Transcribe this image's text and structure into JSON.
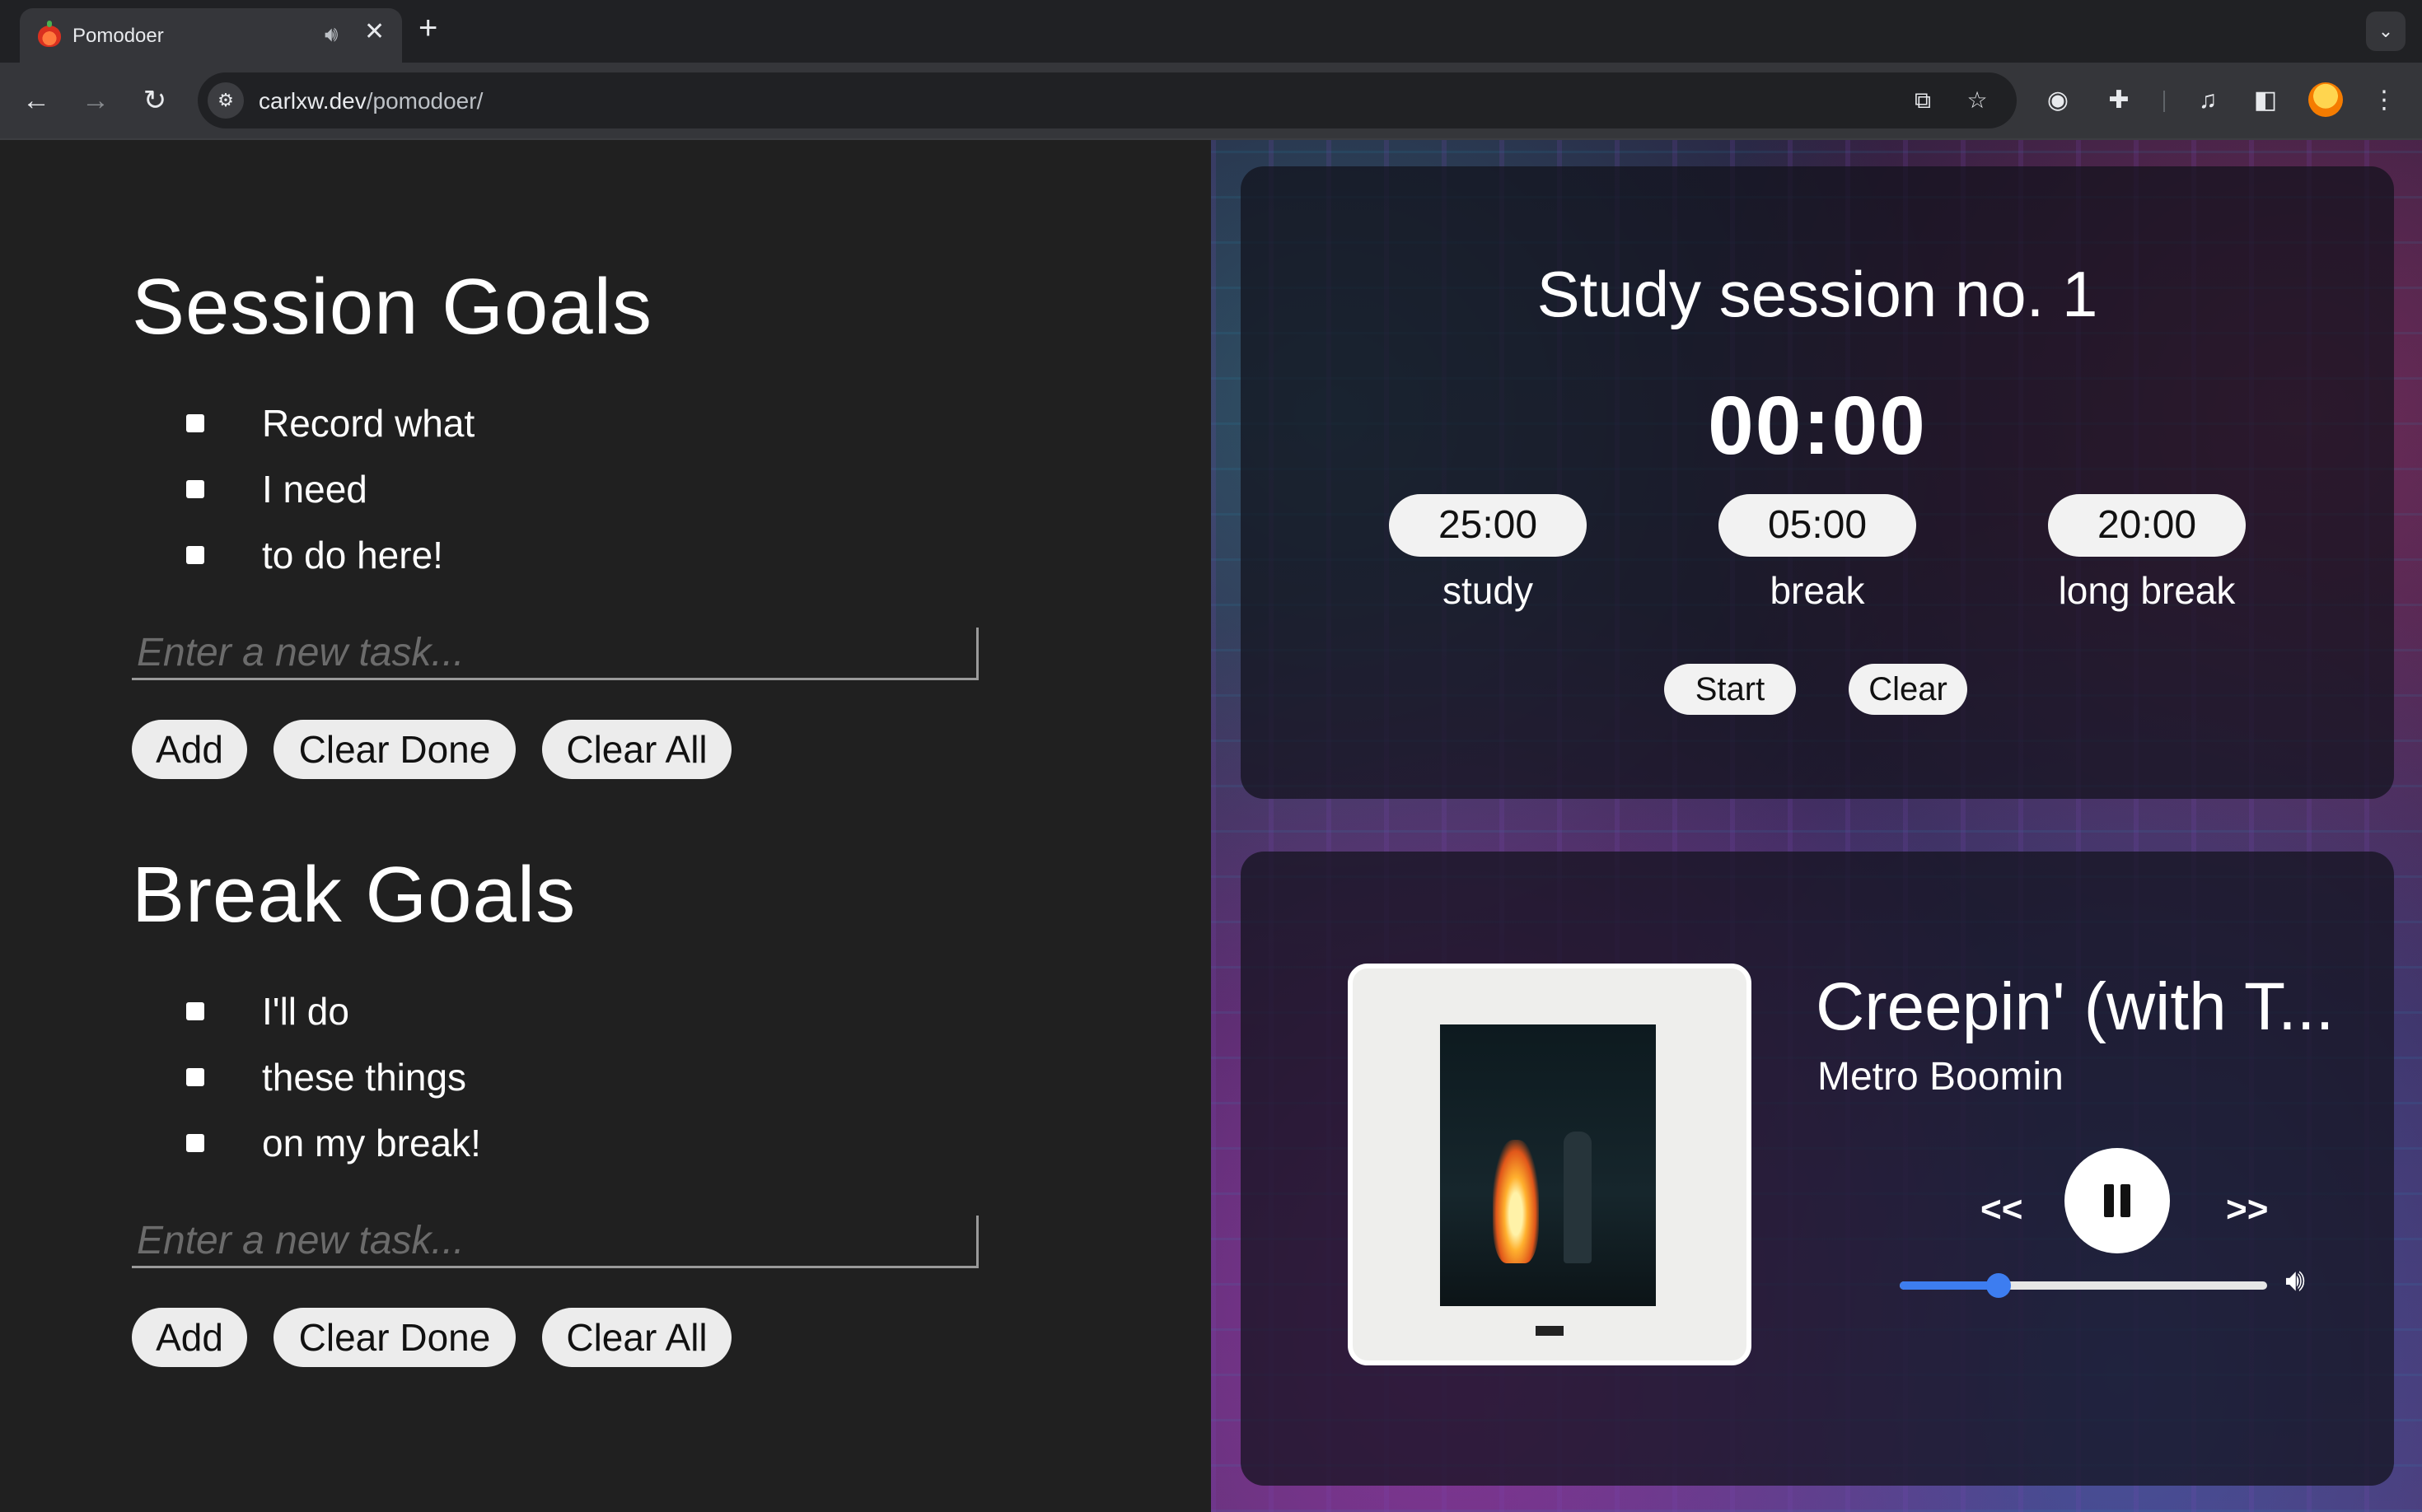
{
  "browser": {
    "tab_title": "Pomodoer",
    "tab_audio_icon": "speaker-icon",
    "tab_close": "✕",
    "new_tab": "+",
    "url_host": "carlxw.dev",
    "url_path": "/pomodoer/"
  },
  "session_goals": {
    "title": "Session Goals",
    "items": [
      "Record what",
      "I need",
      "to do here!"
    ],
    "placeholder": "Enter a new task...",
    "add_label": "Add",
    "clear_done_label": "Clear Done",
    "clear_all_label": "Clear All"
  },
  "break_goals": {
    "title": "Break Goals",
    "items": [
      "I'll do",
      "these things",
      "on my break!"
    ],
    "placeholder": "Enter a new task...",
    "add_label": "Add",
    "clear_done_label": "Clear Done",
    "clear_all_label": "Clear All"
  },
  "timer": {
    "session_title": "Study session no. 1",
    "clock": "00:00",
    "durations": [
      {
        "value": "25:00",
        "label": "study"
      },
      {
        "value": "05:00",
        "label": "break"
      },
      {
        "value": "20:00",
        "label": "long break"
      }
    ],
    "start_label": "Start",
    "clear_label": "Clear"
  },
  "player": {
    "song_title": "Creepin' (with T...",
    "artist": "Metro Boomin",
    "prev_label": "<<",
    "next_label": ">>",
    "volume_fraction": 0.27
  },
  "colors": {
    "accent": "#3d7df0",
    "page_bg": "#202020",
    "card_bg": "rgba(18,18,28,0.72)"
  }
}
